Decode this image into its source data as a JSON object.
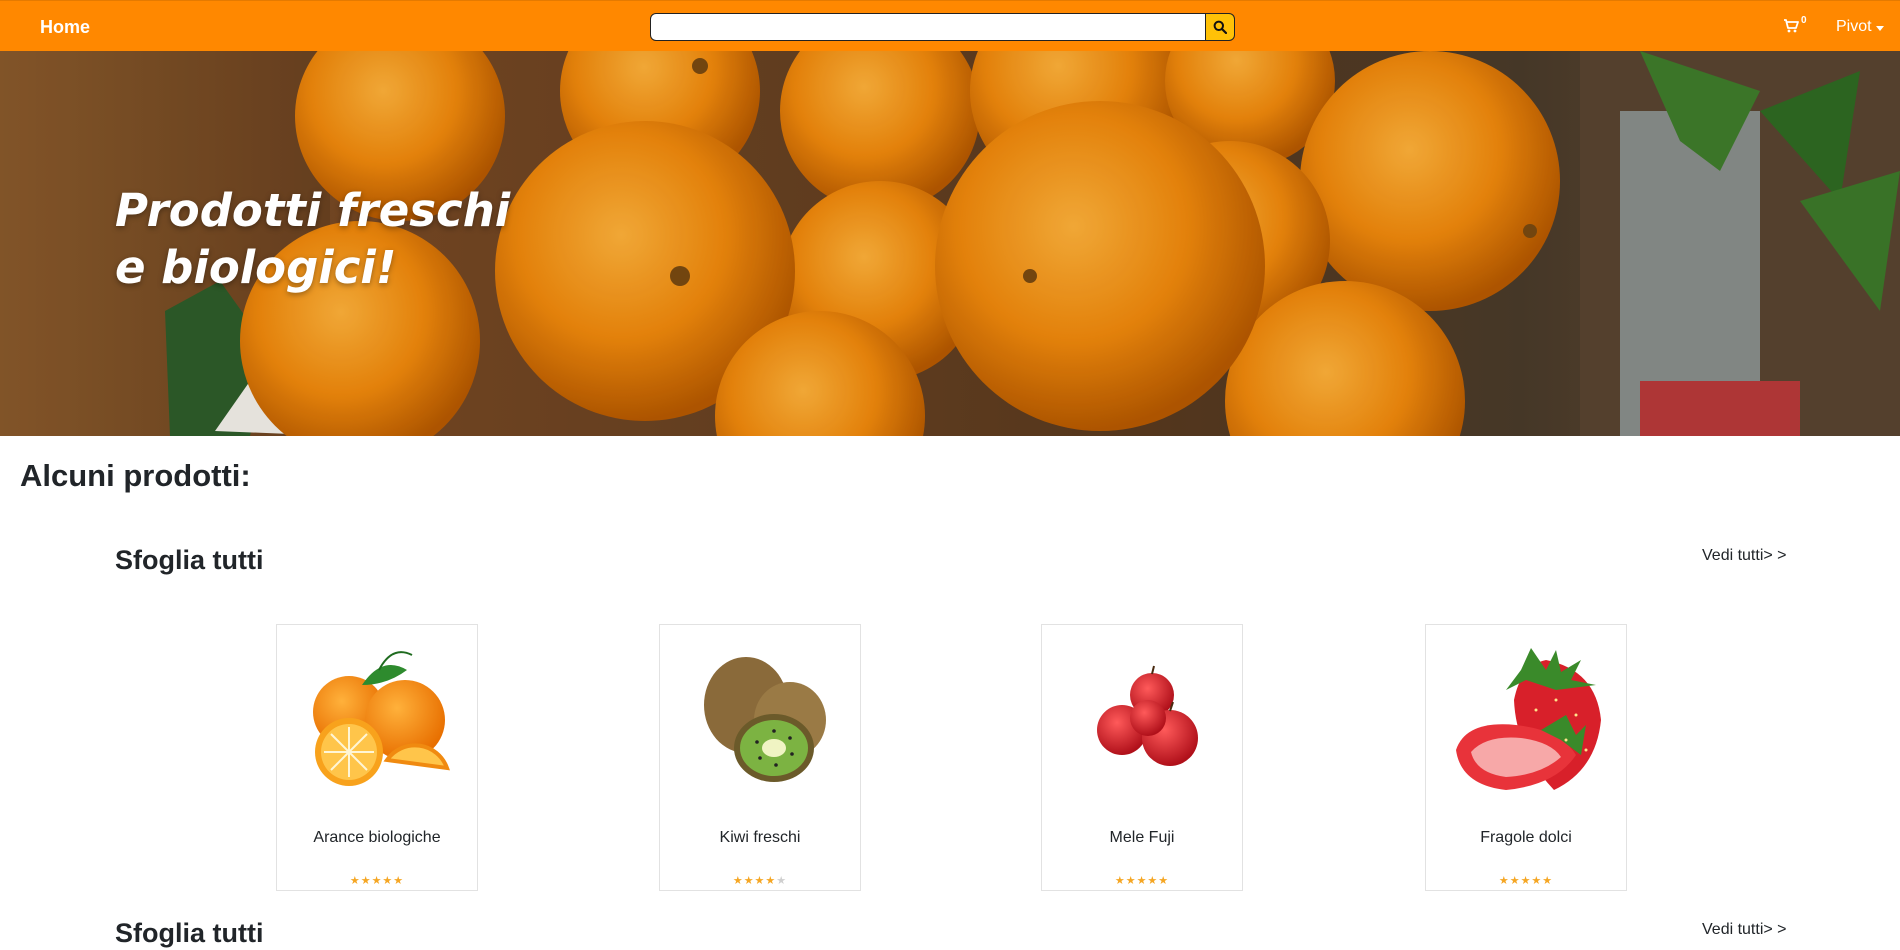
{
  "navbar": {
    "home_label": "Home",
    "search_placeholder": "",
    "search_icon": "search-icon",
    "cart_icon": "cart-icon",
    "cart_count": "0",
    "user_label": "Pivot"
  },
  "hero": {
    "title_line1": "Prodotti freschi",
    "title_line2": "e biologici!"
  },
  "main": {
    "heading": "Alcuni prodotti:",
    "sections": [
      {
        "title": "Sfoglia tutti",
        "view_all": "Vedi tutti> >"
      },
      {
        "title": "Sfoglia tutti",
        "view_all": "Vedi tutti> >"
      }
    ],
    "products": [
      {
        "name": "Arance biologiche",
        "rating": 5,
        "image": "oranges"
      },
      {
        "name": "Kiwi freschi",
        "rating": 4,
        "image": "kiwi"
      },
      {
        "name": "Mele Fuji",
        "rating": 5,
        "image": "apples"
      },
      {
        "name": "Fragole dolci",
        "rating": 5,
        "image": "strawberries"
      }
    ]
  },
  "colors": {
    "navbar": "#ff8800",
    "search_button": "#ffc107",
    "star": "#f5a623"
  }
}
